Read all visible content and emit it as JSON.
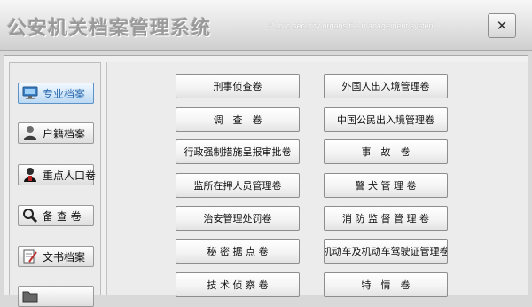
{
  "window": {
    "title_cn": "公安机关档案管理系统",
    "title_en": "Public security organs file management system",
    "close_label": "✕"
  },
  "sidebar": {
    "items": [
      {
        "label": "专业档案",
        "icon": "monitor-icon",
        "active": true
      },
      {
        "label": "户籍档案",
        "icon": "person-icon",
        "active": false
      },
      {
        "label": "重点人口卷",
        "icon": "key-person-icon",
        "active": false
      },
      {
        "label": "备 查 卷",
        "icon": "magnifier-icon",
        "active": false
      },
      {
        "label": "文书档案",
        "icon": "document-pen-icon",
        "active": false
      },
      {
        "label": "",
        "icon": "folder-icon",
        "active": false
      }
    ]
  },
  "categories": {
    "left": [
      "刑事侦查卷",
      "调　查　卷",
      "行政强制措施呈报审批卷",
      "监所在押人员管理卷",
      "治安管理处罚卷",
      "秘 密 据 点 卷",
      "技 术 侦 察 卷"
    ],
    "right": [
      "外国人出入境管理卷",
      "中国公民出入境管理卷",
      "事　故　卷",
      "警 犬 管 理 卷",
      "消 防 监 督 管 理 卷",
      "机动车及机动车驾驶证管理卷",
      "特　情　卷"
    ]
  },
  "colors": {
    "active_sidebar_text": "#2f6fb3",
    "title_text": "#9a9a9a"
  }
}
